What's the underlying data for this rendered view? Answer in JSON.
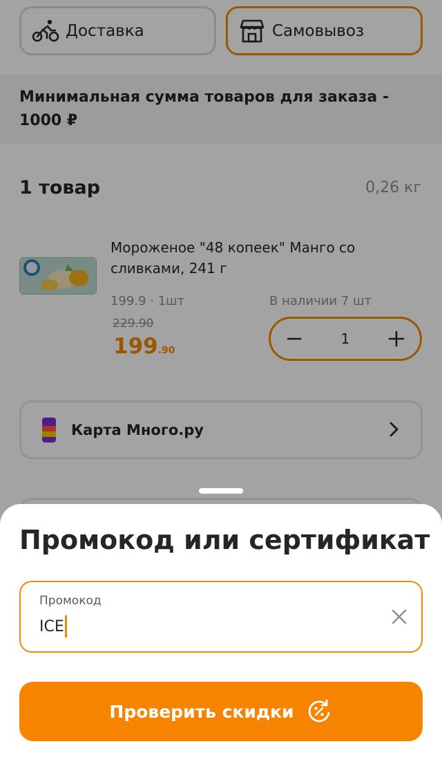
{
  "delivery_modes": {
    "delivery": {
      "label": "Доставка",
      "icon": "bicycle-icon"
    },
    "pickup": {
      "label": "Самовывоз",
      "icon": "store-icon",
      "selected": true
    }
  },
  "min_order": {
    "text": "Минимальная сумма товаров для заказа - 1000 ₽"
  },
  "cart": {
    "items_count_label": "1 товар",
    "total_weight": "0,26 кг",
    "items": [
      {
        "title": "Мороженое \"48 копеек\" Манго со сливками, 241 г",
        "unit_price": "199.9 · 1шт",
        "old_price": "229.90",
        "price_main": "199",
        "price_cents": ".90",
        "stock": "В наличии 7 шт",
        "quantity": "1"
      }
    ]
  },
  "loyalty_card": {
    "label": "Карта Много.ру"
  },
  "promo_sheet": {
    "title": "Промокод или сертификат",
    "field_label": "Промокод",
    "field_value": "ICE",
    "submit_label": "Проверить скидки"
  },
  "colors": {
    "accent": "#f78400",
    "accent_border": "#f08a00",
    "muted_text": "#8c8c8c",
    "banner_bg": "#f3f5f4"
  }
}
